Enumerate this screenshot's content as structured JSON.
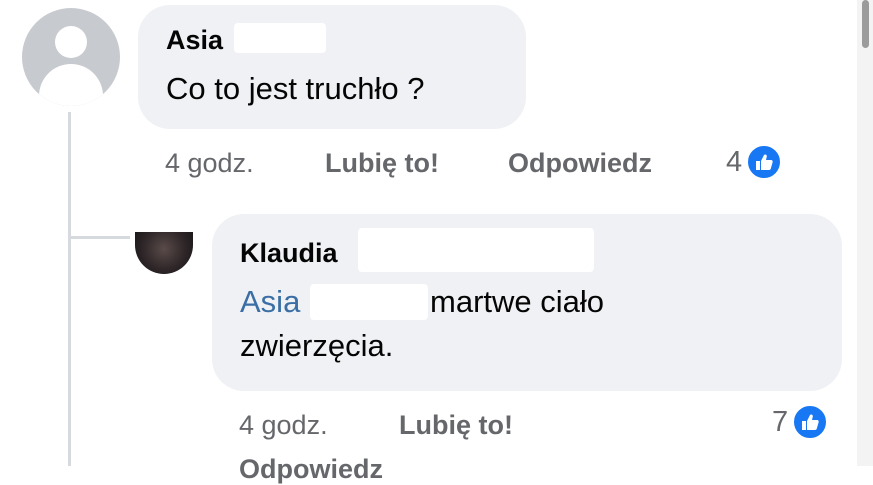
{
  "comment1": {
    "author": "Asia",
    "text": "Co to jest truchło ?",
    "time": "4 godz.",
    "like_label": "Lubię to!",
    "reply_label": "Odpowiedz",
    "reaction_count": "4",
    "reaction_icon": "like-icon"
  },
  "comment2": {
    "author": "Klaudia",
    "mention": "Asia",
    "text_line1": "martwe ciało",
    "text_line2": "zwierzęcia.",
    "time": "4 godz.",
    "like_label": "Lubię to!",
    "reaction_count": "7",
    "reaction_icon": "like-icon",
    "cut_off_reply_label": "Odpowiedz"
  },
  "colors": {
    "bubble": "#eff1f4",
    "mention": "#3a6ea5",
    "secondary_text": "#65676b",
    "like_blue": "#1877f2"
  }
}
